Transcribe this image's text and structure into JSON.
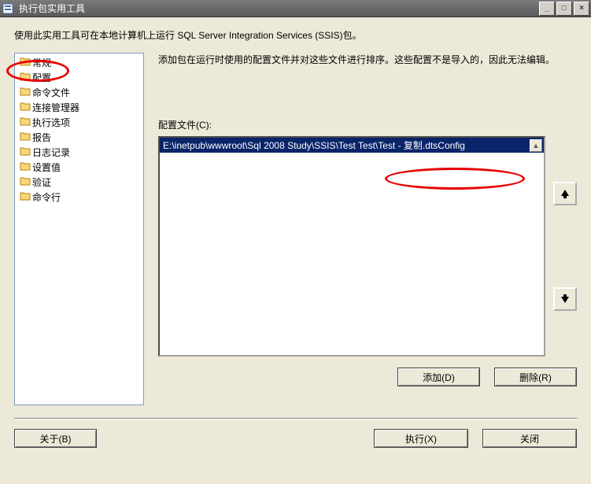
{
  "window": {
    "title": "执行包实用工具"
  },
  "description": "使用此实用工具可在本地计算机上运行 SQL Server Integration Services (SSIS)包。",
  "tree": {
    "items": [
      {
        "label": "常规"
      },
      {
        "label": "配置"
      },
      {
        "label": "命令文件"
      },
      {
        "label": "连接管理器"
      },
      {
        "label": "执行选项"
      },
      {
        "label": "报告"
      },
      {
        "label": "日志记录"
      },
      {
        "label": "设置值"
      },
      {
        "label": "验证"
      },
      {
        "label": "命令行"
      }
    ]
  },
  "right": {
    "description": "添加包在运行时使用的配置文件并对这些文件进行排序。这些配置不是导入的，因此无法编辑。",
    "files_label": "配置文件(C):",
    "files": [
      "E:\\inetpub\\wwwroot\\Sql 2008 Study\\SSIS\\Test Test\\Test - 复制.dtsConfig"
    ]
  },
  "buttons": {
    "add": "添加(D)",
    "remove": "删除(R)",
    "about": "关于(B)",
    "execute": "执行(X)",
    "close": "关闭"
  },
  "icons": {
    "app": "app-icon",
    "tree": "folder-icon"
  }
}
